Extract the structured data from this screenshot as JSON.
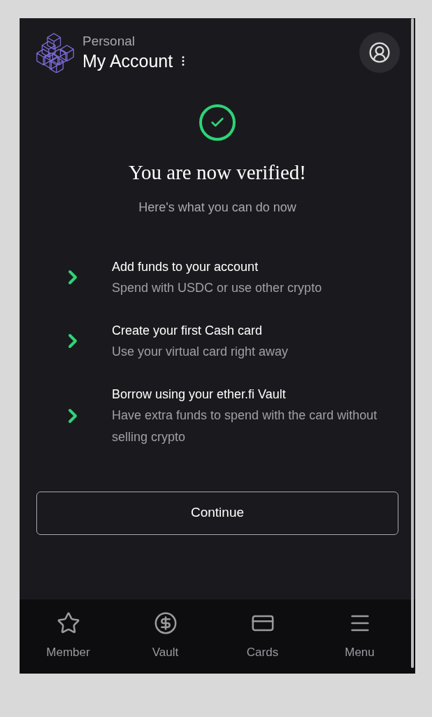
{
  "header": {
    "subtitle": "Personal",
    "title": "My Account"
  },
  "verified": {
    "title": "You are now verified!",
    "subtitle": "Here's what you can do now"
  },
  "steps": [
    {
      "title": "Add funds to your account",
      "description": "Spend with USDC or use other crypto"
    },
    {
      "title": "Create your first Cash card",
      "description": "Use your virtual card right away"
    },
    {
      "title": "Borrow using your ether.fi Vault",
      "description": "Have extra funds to spend with the card without selling crypto"
    }
  ],
  "continue_button": "Continue",
  "bottom_nav": [
    {
      "kind": "star",
      "label": "Member"
    },
    {
      "kind": "dollar",
      "label": "Vault"
    },
    {
      "kind": "card",
      "label": "Cards"
    },
    {
      "kind": "menu",
      "label": "Menu"
    }
  ]
}
